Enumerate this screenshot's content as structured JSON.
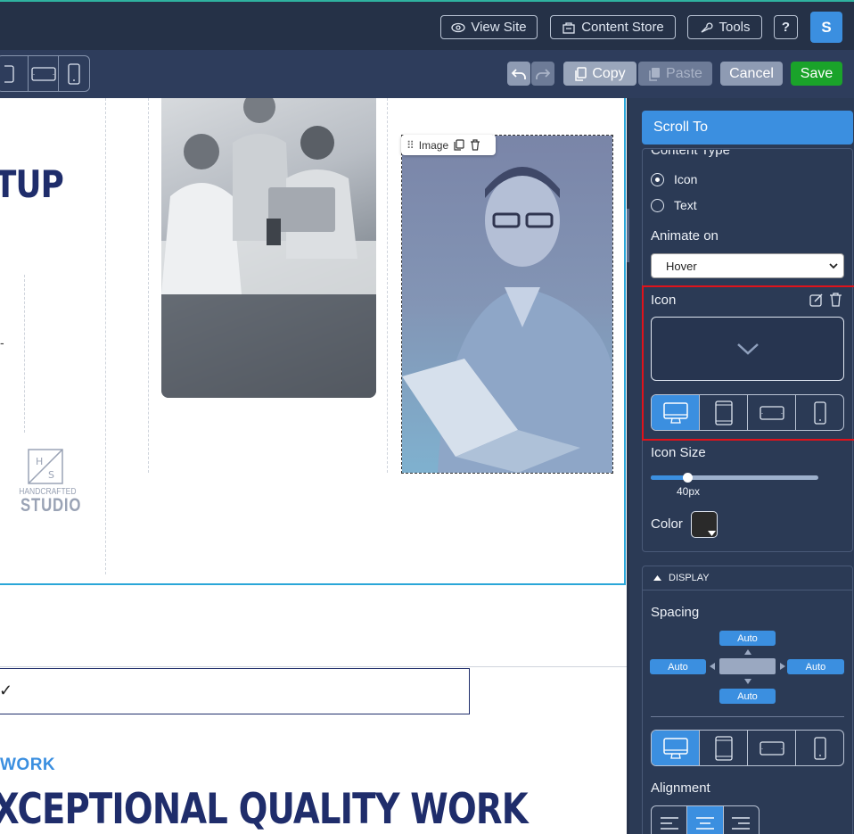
{
  "topbar": {
    "view_site": "View Site",
    "content_store": "Content Store",
    "tools": "Tools",
    "help": "?",
    "avatar": "S"
  },
  "toolbar": {
    "copy": "Copy",
    "paste": "Paste",
    "cancel": "Cancel",
    "save": "Save"
  },
  "canvas": {
    "hero_text": "TUP",
    "image_toolbar_label": "Image",
    "logo_top": "H",
    "logo_bottom": "S",
    "logo_line1": "HANDCRAFTED",
    "logo_line2": "STUDIO",
    "checkmark": "✓",
    "work_label": "WORK",
    "big_heading": "XCEPTIONAL QUALITY WORK",
    "dash_mark": "-"
  },
  "panel": {
    "scroll_to": "Scroll To",
    "content_type_label": "Content Type",
    "radio_icon": "Icon",
    "radio_text": "Text",
    "animate_on_label": "Animate on",
    "animate_on_value": "Hover",
    "icon_label": "Icon",
    "icon_size_label": "Icon Size",
    "icon_size_value": "40px",
    "icon_size_fraction": 0.22,
    "color_label": "Color",
    "display_header": "DISPLAY",
    "spacing_label": "Spacing",
    "spacing_top": "Auto",
    "spacing_left": "Auto",
    "spacing_right": "Auto",
    "spacing_bottom": "Auto",
    "alignment_label": "Alignment"
  },
  "colors": {
    "accent": "#3b8fe0",
    "save_green": "#1aa32a",
    "highlight_red": "#e0131b",
    "heading_navy": "#1f2d6b"
  }
}
